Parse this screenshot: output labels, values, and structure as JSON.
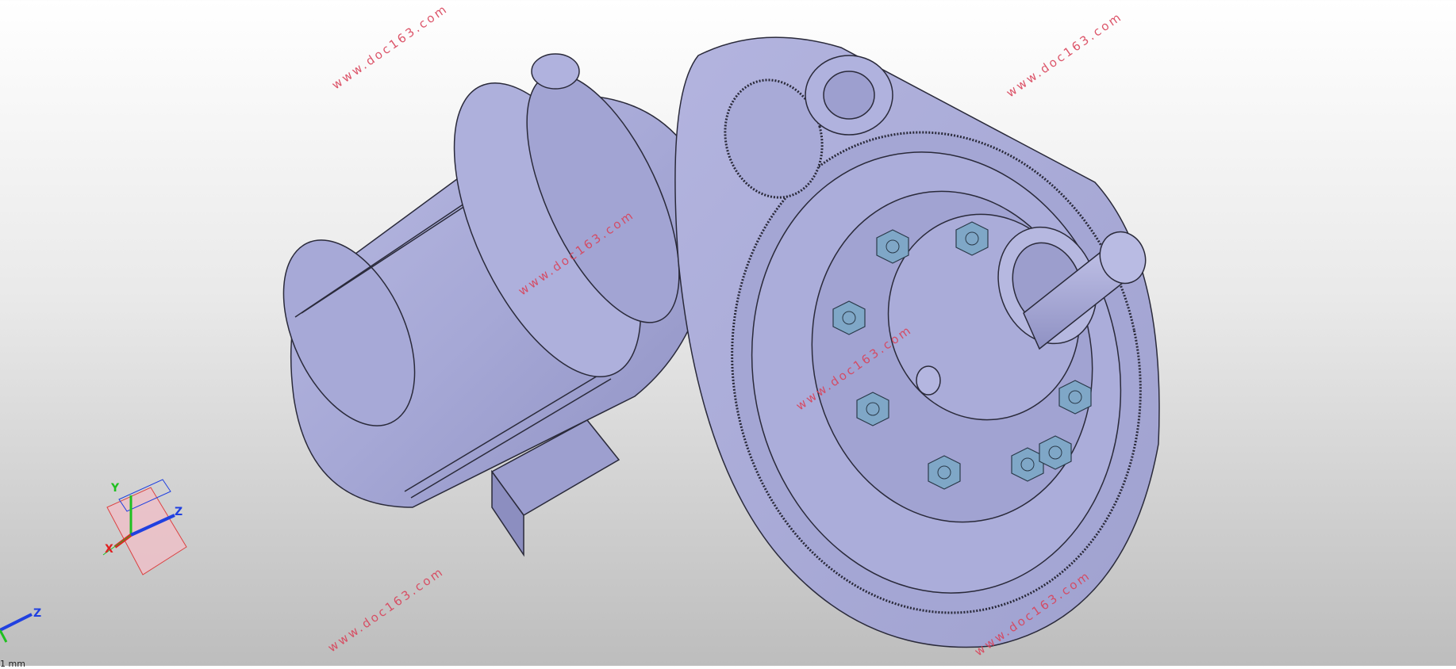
{
  "watermark": {
    "text": "www.doc163.com",
    "color": "#d9435a"
  },
  "view_triad": {
    "labels": {
      "x": "X",
      "y": "Y",
      "z": "Z"
    },
    "colors": {
      "x": "#e02020",
      "y": "#20c020",
      "z": "#2040e0"
    }
  },
  "origin_triad": {
    "labels": {
      "z": "Z"
    }
  },
  "model": {
    "body_color": "#a9aad4",
    "nut_color": "#7fa7c7"
  },
  "status": {
    "text": "1 mm"
  }
}
